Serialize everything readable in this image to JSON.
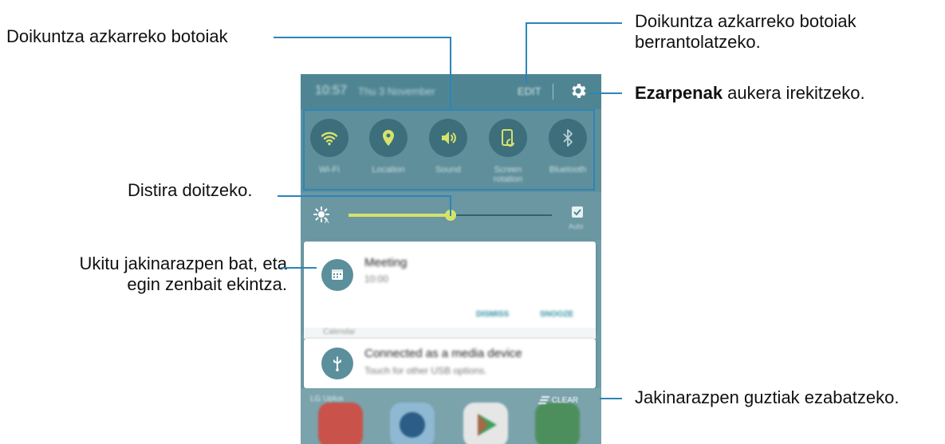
{
  "callouts": {
    "quick_buttons": "Doikuntza azkarreko botoiak",
    "rearrange_line1": "Doikuntza azkarreko botoiak",
    "rearrange_line2": "berrantolatzeko.",
    "settings_bold": "Ezarpenak",
    "settings_rest": " aukera irekitzeko.",
    "brightness": "Distira doitzeko.",
    "notification_line1": "Ukitu jakinarazpen bat, eta",
    "notification_line2": "egin zenbait ekintza.",
    "clear_all": "Jakinarazpen guztiak ezabatzeko."
  },
  "phone": {
    "status": {
      "time": "10:57",
      "date": "Thu 3 November",
      "edit_label": "EDIT"
    },
    "quick_settings": [
      {
        "label": "Wi-Fi",
        "icon": "wifi-icon"
      },
      {
        "label": "Location",
        "icon": "location-icon"
      },
      {
        "label": "Sound",
        "icon": "sound-icon"
      },
      {
        "label": "Screen rotation",
        "icon": "screen-rotation-icon"
      },
      {
        "label": "Bluetooth",
        "icon": "bluetooth-icon"
      }
    ],
    "brightness": {
      "level": 0.5,
      "auto_label": "Auto"
    },
    "notifications": [
      {
        "title": "Meeting",
        "subtitle": "10:00",
        "actions": [
          "DISMISS",
          "SNOOZE"
        ],
        "icon": "calendar-icon"
      },
      {
        "title": "Connected as a media device",
        "subtitle": "Touch for other USB options.",
        "icon": "usb-icon"
      }
    ],
    "mid_text": "Calendar",
    "dock": {
      "left_text": "LG Uplus",
      "clear_label": "CLEAR"
    }
  },
  "colors": {
    "accent": "#d6e36b",
    "line": "#2b86b8"
  }
}
